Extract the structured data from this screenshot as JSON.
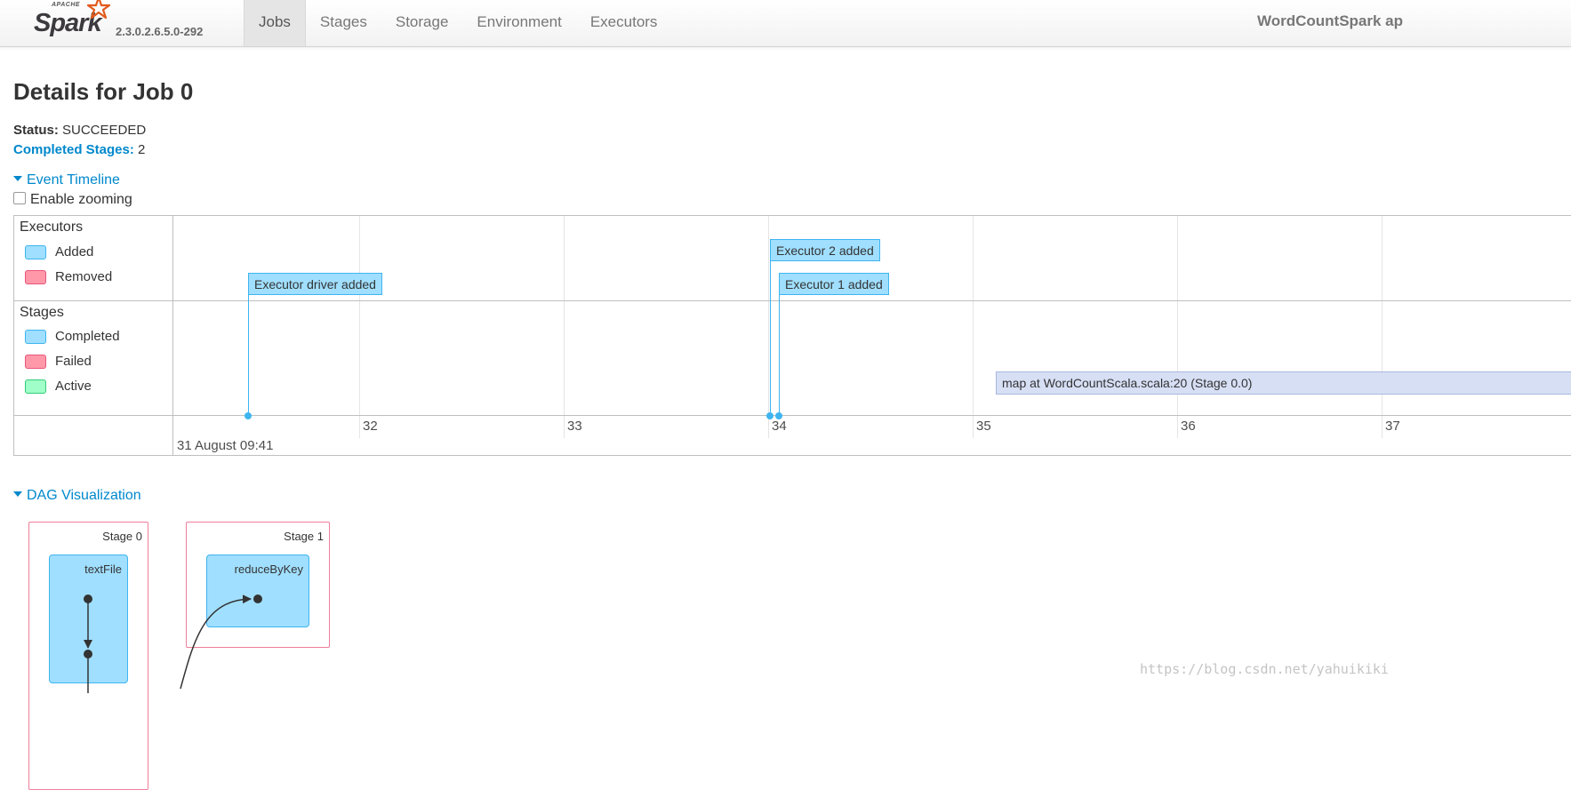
{
  "header": {
    "logo_apache": "APACHE",
    "logo_spark": "Spark",
    "version": "2.3.0.2.6.5.0-292",
    "tabs": [
      {
        "label": "Jobs",
        "active": true
      },
      {
        "label": "Stages",
        "active": false
      },
      {
        "label": "Storage",
        "active": false
      },
      {
        "label": "Environment",
        "active": false
      },
      {
        "label": "Executors",
        "active": false
      }
    ],
    "app_name": "WordCountSpark ap"
  },
  "page": {
    "title": "Details for Job 0",
    "status_label": "Status:",
    "status_value": "SUCCEEDED",
    "completed_label": "Completed Stages:",
    "completed_value": "2"
  },
  "timeline": {
    "toggle_label": "Event Timeline",
    "zoom_label": "Enable zooming",
    "zoom_checked": false,
    "groups": {
      "executors": "Executors",
      "stages": "Stages"
    },
    "legend_executors": [
      {
        "label": "Added",
        "color": "#a0dfff",
        "border": "#3eb5f0"
      },
      {
        "label": "Removed",
        "color": "#ff99aa",
        "border": "#e8557a"
      }
    ],
    "legend_stages": [
      {
        "label": "Completed",
        "color": "#a0dfff",
        "border": "#3eb5f0"
      },
      {
        "label": "Failed",
        "color": "#ff99aa",
        "border": "#e8557a"
      },
      {
        "label": "Active",
        "color": "#a0ffc8",
        "border": "#33cc77"
      }
    ],
    "events": {
      "driver_added": "Executor driver added",
      "exec2_added": "Executor 2 added",
      "exec1_added": "Executor 1 added"
    },
    "stage_bar": "map at WordCountScala.scala:20 (Stage 0.0)",
    "ticks": [
      "32",
      "33",
      "34",
      "35",
      "36",
      "37"
    ],
    "axis_date": "31 August 09:41"
  },
  "dag": {
    "toggle_label": "DAG Visualization",
    "stages": [
      {
        "label": "Stage 0",
        "op": "textFile"
      },
      {
        "label": "Stage 1",
        "op": "reduceByKey"
      }
    ]
  },
  "watermark": "https://blog.csdn.net/yahuikiki"
}
